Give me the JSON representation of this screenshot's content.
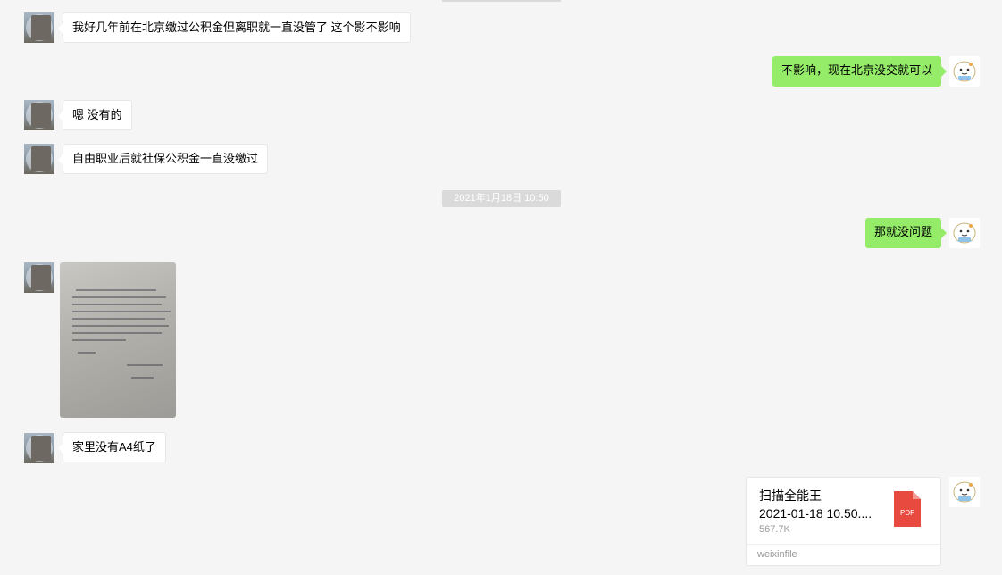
{
  "timestamp": "2021年1月18日 10:50",
  "messages": [
    {
      "side": "left",
      "text": "我好几年前在北京缴过公积金但离职就一直没管了 这个影不影响"
    },
    {
      "side": "right",
      "text": "不影响，现在北京没交就可以"
    },
    {
      "side": "left",
      "text": "嗯 没有的"
    },
    {
      "side": "left",
      "text": "自由职业后就社保公积金一直没缴过"
    },
    {
      "side": "right",
      "text": "那就没问题"
    },
    {
      "side": "left",
      "text": "家里没有A4纸了"
    }
  ],
  "file": {
    "name_line1": "扫描全能王",
    "name_line2": "2021-01-18 10.50....",
    "size": "567.7K",
    "source": "weixinfile",
    "icon": "pdf-icon",
    "icon_label": "PDF",
    "icon_color": "#e94a3f"
  },
  "colors": {
    "self_bubble": "#95ec69",
    "other_bubble": "#ffffff",
    "background": "#f5f5f5"
  }
}
